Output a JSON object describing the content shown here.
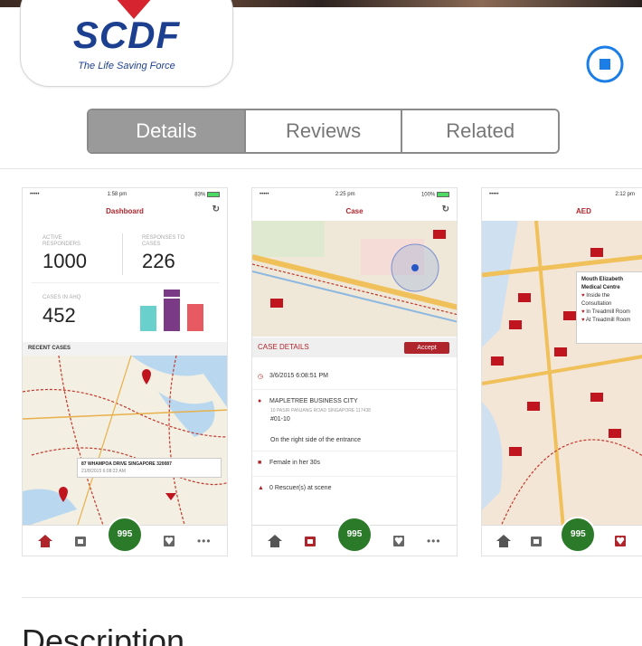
{
  "app": {
    "logo_text": "SCDF",
    "tagline": "The Life Saving Force"
  },
  "segments": [
    {
      "label": "Details",
      "active": true
    },
    {
      "label": "Reviews",
      "active": false
    },
    {
      "label": "Related",
      "active": false
    }
  ],
  "screenshots": {
    "dashboard": {
      "status_left": "•••••",
      "status_time": "1:58 pm",
      "status_right": "83%",
      "title": "Dashboard",
      "active_label": "ACTIVE RESPONDERS",
      "active_value": "1000",
      "responses_label": "RESPONSES TO CASES",
      "responses_value": "226",
      "cases_label": "CASES IN AHQ",
      "cases_value": "452",
      "recent_label": "RECENT CASES",
      "card_address": "87 WHAMPOA DRIVE SINGAPORE 320087",
      "card_time": "21/8/2015 6:08:22 AM",
      "call_label": "995"
    },
    "case": {
      "status_left": "•••••",
      "status_time": "2:25 pm",
      "status_right": "100%",
      "title": "Case",
      "header": "CASE DETAILS",
      "accept": "Accept",
      "datetime": "3/6/2015 6:08:51 PM",
      "place": "MAPLETREE BUSINESS CITY",
      "address": "10 PASIR PANJANG ROAD SINGAPORE 117438",
      "unit": "#01-10",
      "note": "On the right side of the entrance",
      "patient": "Female in her 30s",
      "rescuers": "0 Rescuer(s) at scene",
      "call_label": "995"
    },
    "aed": {
      "status_left": "•••••",
      "status_time": "2:12 pm",
      "title": "AED",
      "card_title": "Mouth Elizabeth Medical Centre",
      "rows": [
        "Inside the Consultation",
        "In Treadmill Room",
        "At Treadmill Room"
      ],
      "call_label": "995"
    }
  },
  "section": {
    "description": "Description"
  }
}
